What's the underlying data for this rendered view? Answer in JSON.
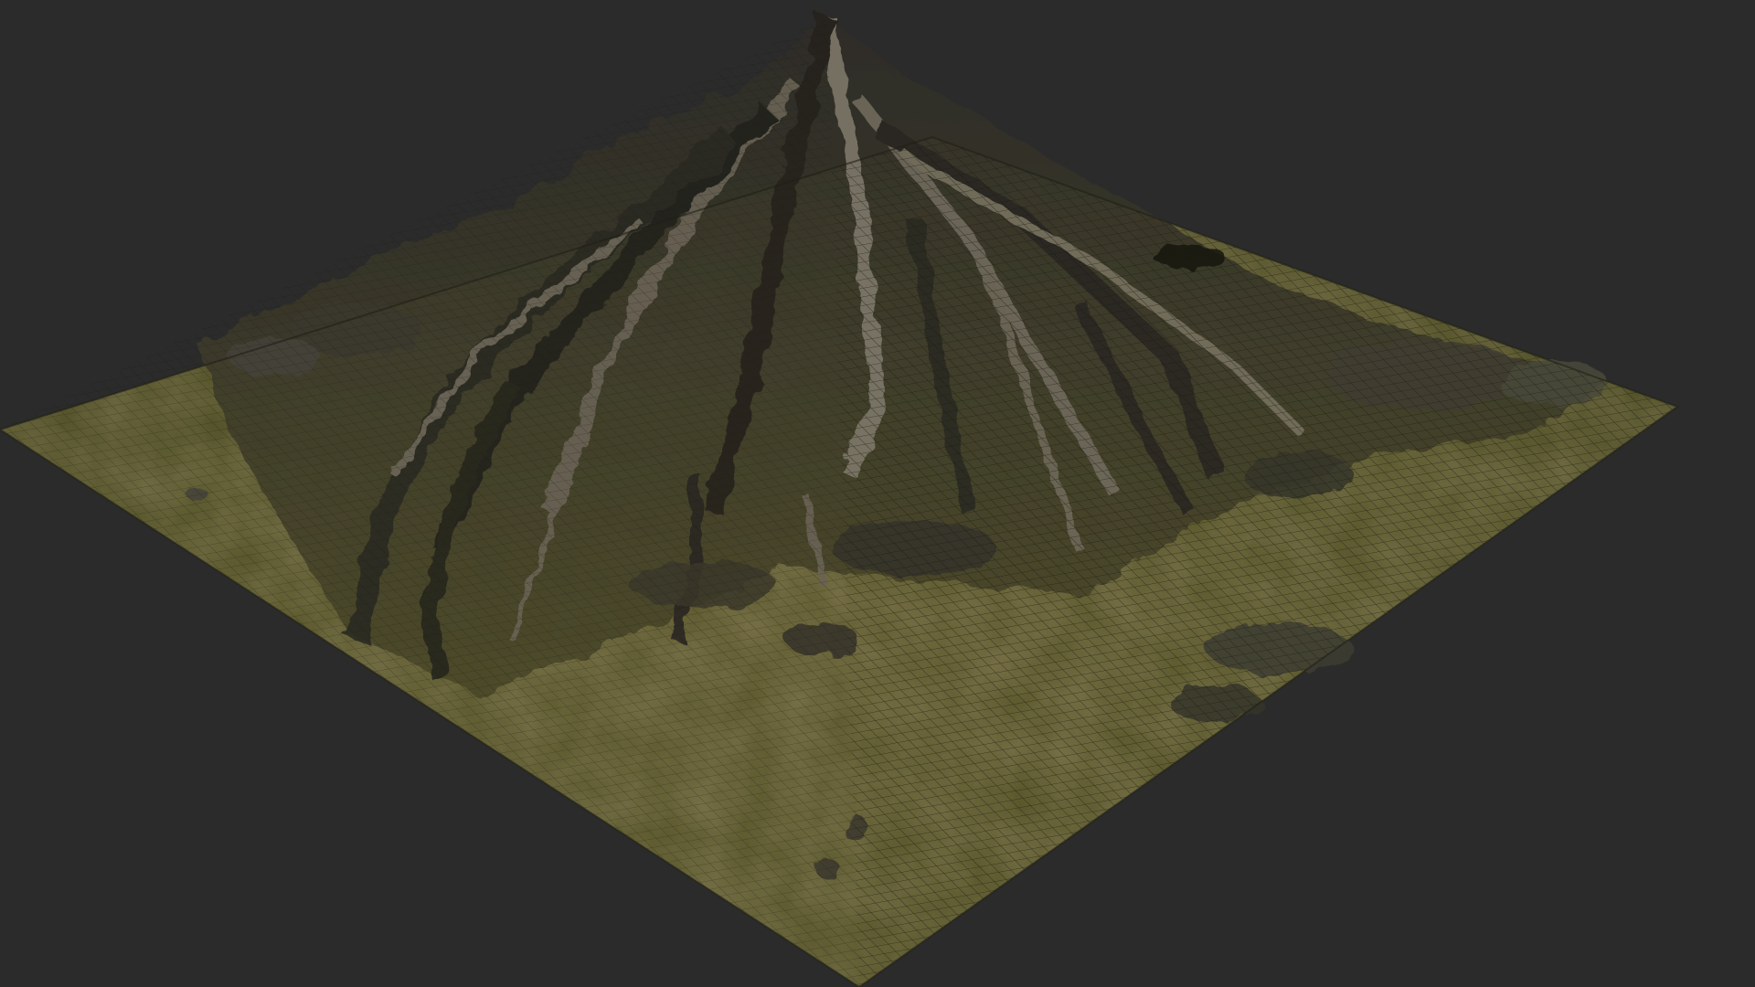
{
  "scene": {
    "background_color": "#2b2b2b",
    "object": "terrain-mesh",
    "wireframe_overlay": true,
    "colors": {
      "grass": "#5a5a28",
      "grass_dark": "#3f4220",
      "dirt": "#6b5a3a",
      "rock_light": "#8b8578",
      "rock_dark": "#2a2a26",
      "wire": "#1a1a14"
    }
  }
}
